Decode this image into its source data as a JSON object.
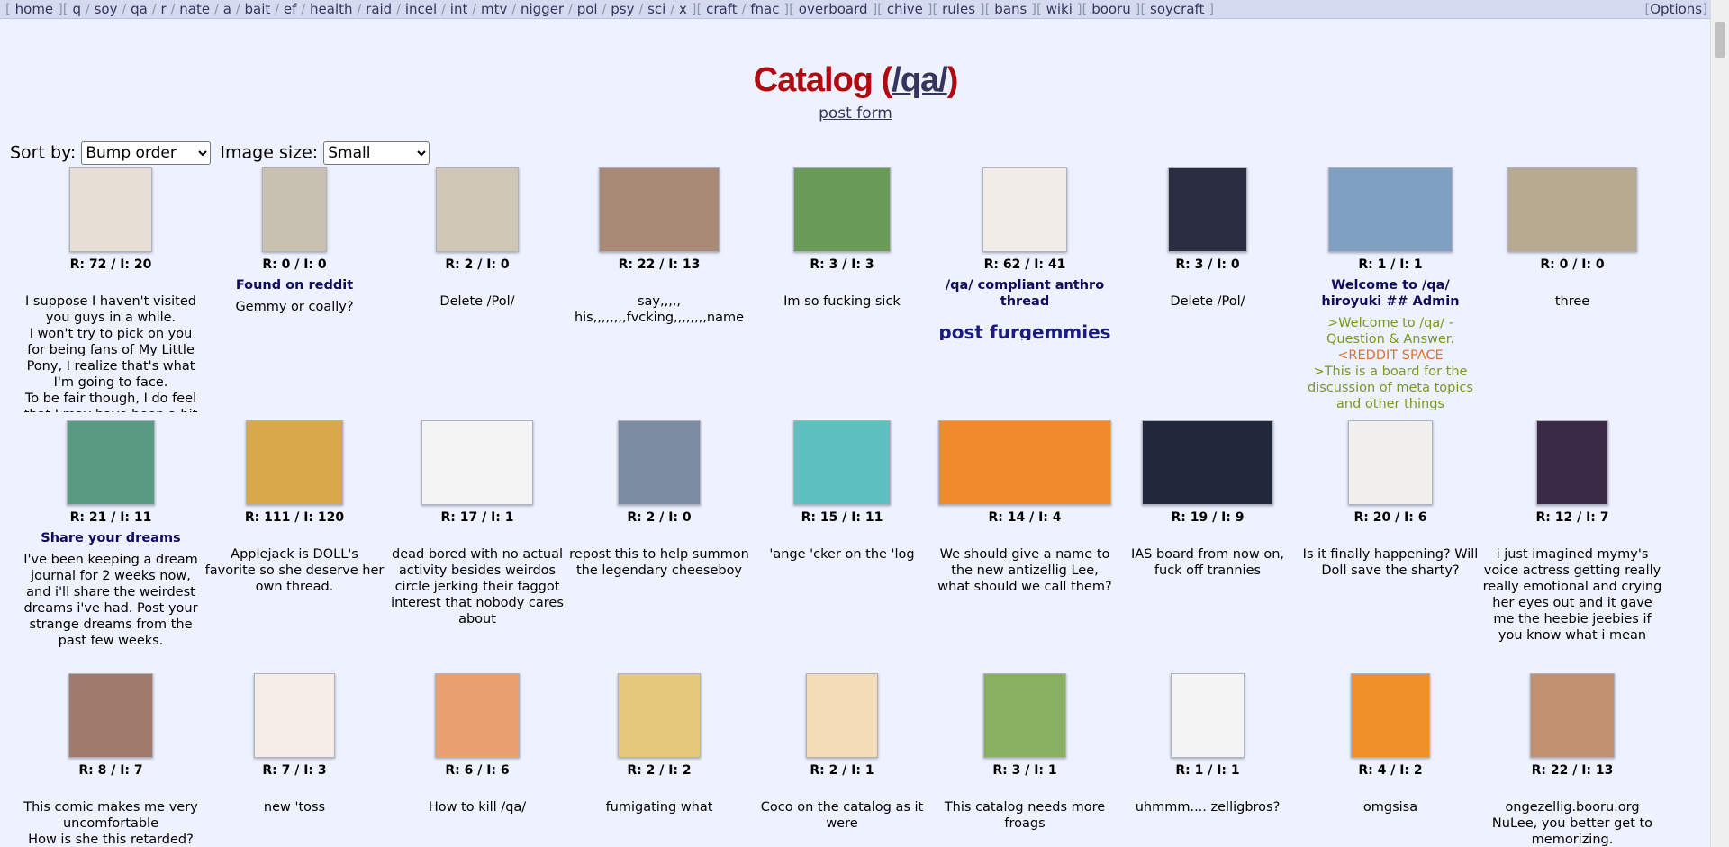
{
  "nav": {
    "links": [
      "home",
      "q",
      "soy",
      "qa",
      "r",
      "nate",
      "a",
      "bait",
      "ef",
      "health",
      "raid",
      "incel",
      "int",
      "mtv",
      "nigger",
      "pol",
      "psy",
      "sci",
      "x",
      "craft",
      "fnac",
      "overboard",
      "chive",
      "rules",
      "bans",
      "wiki",
      "booru",
      "soycraft"
    ],
    "options_label": "Options"
  },
  "header": {
    "title_prefix": "Catalog (",
    "board": "/qa/",
    "title_suffix": ")",
    "post_form": "post form"
  },
  "controls": {
    "sort_label": "Sort by:",
    "sort_value": "Bump order",
    "size_label": "Image size:",
    "size_value": "Small"
  },
  "threads": [
    {
      "stats": "R: 72 / I: 20",
      "subject": "",
      "body": [
        "I suppose I haven't visited you guys in a while.",
        "I won't try to pick on you for being fans of My Little Pony, I realize that's what I'm going to face.",
        "To be fair though, I do feel that I may have been a bit"
      ],
      "thumb": "#e8e0d6",
      "w": 90,
      "h": 92
    },
    {
      "stats": "R: 0 / I: 0",
      "subject": "Found on reddit",
      "body": [
        "Gemmy or coally?"
      ],
      "thumb": "#c8c0b0",
      "w": 70,
      "h": 92
    },
    {
      "stats": "R: 2 / I: 0",
      "subject": "",
      "body": [
        "Delete /Pol/"
      ],
      "thumb": "#cfc6b6",
      "w": 90,
      "h": 92
    },
    {
      "stats": "R: 22 / I: 13",
      "subject": "",
      "body": [
        "say,,,,,",
        "his,,,,,,,,fvcking,,,,,,,,name"
      ],
      "thumb": "#a88a76",
      "w": 132,
      "h": 92
    },
    {
      "stats": "R: 3 / I: 3",
      "subject": "",
      "body": [
        "Im so fucking sick"
      ],
      "thumb": "#6a9a58",
      "w": 106,
      "h": 92
    },
    {
      "stats": "R: 62 / I: 41",
      "subject": "/qa/ compliant anthro thread",
      "body": [],
      "big": "post furgemmies",
      "thumb": "#f2ece8",
      "w": 92,
      "h": 92
    },
    {
      "stats": "R: 3 / I: 0",
      "subject": "",
      "body": [
        "Delete /Pol/"
      ],
      "thumb": "#2a2e40",
      "w": 86,
      "h": 92
    },
    {
      "stats": "R: 1 / I: 1",
      "subject": "Welcome to /qa/ hiroyuki ## Admin",
      "body": [],
      "green": [
        ">Welcome to /qa/ - Question & Answer."
      ],
      "orange": [
        "<REDDIT SPACE"
      ],
      "green2": [
        ">This is a board for the discussion of meta topics and other things"
      ],
      "thumb": "#7fa0c0",
      "w": 136,
      "h": 92
    },
    {
      "stats": "R: 0 / I: 0",
      "subject": "",
      "body": [
        "three"
      ],
      "thumb": "#b8aa90",
      "w": 142,
      "h": 92
    },
    {
      "stats": "R: 21 / I: 11",
      "subject": "Share your dreams",
      "body": [
        "I've been keeping a dream journal for 2 weeks now, and i'll share the weirdest dreams i've had. Post your strange dreams from the past few weeks."
      ],
      "thumb": "#5a9a80",
      "w": 96,
      "h": 92
    },
    {
      "stats": "R: 111 / I: 120",
      "subject": "",
      "body": [
        "Applejack is DOLL's favorite so she deserve her own thread."
      ],
      "thumb": "#d9a84a",
      "w": 106,
      "h": 92
    },
    {
      "stats": "R: 17 / I: 1",
      "subject": "",
      "body": [
        "dead bored with no actual activity besides weirdos circle jerking their faggot interest that nobody cares about"
      ],
      "thumb": "#f4f4f4",
      "w": 122,
      "h": 92
    },
    {
      "stats": "R: 2 / I: 0",
      "subject": "",
      "body": [
        "repost this to help summon the legendary cheeseboy"
      ],
      "thumb": "#7c8ca0",
      "w": 90,
      "h": 92
    },
    {
      "stats": "R: 15 / I: 11",
      "subject": "",
      "body": [
        "'ange 'cker on the 'log"
      ],
      "thumb": "#5fc0c0",
      "w": 106,
      "h": 92
    },
    {
      "stats": "R: 14 / I: 4",
      "subject": "",
      "body": [
        "We should give a name to the new antizellig Lee, what should we call them?"
      ],
      "thumb": "#f08a2a",
      "w": 190,
      "h": 92
    },
    {
      "stats": "R: 19 / I: 9",
      "subject": "",
      "body": [
        "IAS board from now on, fuck off trannies"
      ],
      "thumb": "#20283a",
      "w": 144,
      "h": 92
    },
    {
      "stats": "R: 20 / I: 6",
      "subject": "",
      "body": [
        "Is it finally happening? Will Doll save the sharty?"
      ],
      "thumb": "#f2f0ec",
      "w": 92,
      "h": 92
    },
    {
      "stats": "R: 12 / I: 7",
      "subject": "",
      "body": [
        "i just imagined mymy's voice actress getting really really emotional and crying her eyes out and it gave me the heebie jeebies if you know what i mean"
      ],
      "thumb": "#3a2a48",
      "w": 78,
      "h": 92
    },
    {
      "stats": "R: 8 / I: 7",
      "subject": "",
      "body": [
        "This comic makes me very uncomfortable",
        "How is she this retarded?"
      ],
      "thumb": "#a07a6a",
      "w": 92,
      "h": 92
    },
    {
      "stats": "R: 7 / I: 3",
      "subject": "",
      "body": [
        "new 'toss"
      ],
      "thumb": "#f4eee6",
      "w": 88,
      "h": 92
    },
    {
      "stats": "R: 6 / I: 6",
      "subject": "",
      "body": [
        "How to kill /qa/"
      ],
      "thumb": "#e8a070",
      "w": 92,
      "h": 92
    },
    {
      "stats": "R: 2 / I: 2",
      "subject": "",
      "body": [
        "fumigating what"
      ],
      "thumb": "#e6c87a",
      "w": 90,
      "h": 92
    },
    {
      "stats": "R: 2 / I: 1",
      "subject": "",
      "body": [
        "Coco on the catalog as it were"
      ],
      "thumb": "#f4dcb8",
      "w": 78,
      "h": 92
    },
    {
      "stats": "R: 3 / I: 1",
      "subject": "",
      "body": [
        "This catalog needs more froags"
      ],
      "thumb": "#88b060",
      "w": 90,
      "h": 92
    },
    {
      "stats": "R: 1 / I: 1",
      "subject": "",
      "body": [
        "uhmmm.... zelligbros?"
      ],
      "thumb": "#f4f4f4",
      "w": 80,
      "h": 92
    },
    {
      "stats": "R: 4 / I: 2",
      "subject": "",
      "body": [
        "omgsisa"
      ],
      "thumb": "#f0902a",
      "w": 86,
      "h": 92
    },
    {
      "stats": "R: 22 / I: 13",
      "subject": "",
      "body": [
        "ongezellig.booru.org NuLee, you better get to memorizing."
      ],
      "thumb": "#c09070",
      "w": 92,
      "h": 92
    }
  ]
}
